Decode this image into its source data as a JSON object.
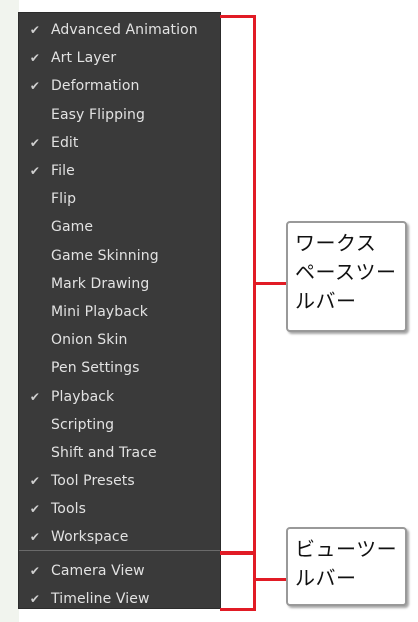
{
  "workspace_menu": {
    "items": [
      {
        "label": "Advanced Animation",
        "checked": true
      },
      {
        "label": "Art Layer",
        "checked": true
      },
      {
        "label": "Deformation",
        "checked": true
      },
      {
        "label": "Easy Flipping",
        "checked": false
      },
      {
        "label": "Edit",
        "checked": true
      },
      {
        "label": "File",
        "checked": true
      },
      {
        "label": "Flip",
        "checked": false
      },
      {
        "label": "Game",
        "checked": false
      },
      {
        "label": "Game Skinning",
        "checked": false
      },
      {
        "label": "Mark Drawing",
        "checked": false
      },
      {
        "label": "Mini Playback",
        "checked": false
      },
      {
        "label": "Onion Skin",
        "checked": false
      },
      {
        "label": "Pen Settings",
        "checked": false
      },
      {
        "label": "Playback",
        "checked": true
      },
      {
        "label": "Scripting",
        "checked": false
      },
      {
        "label": "Shift and Trace",
        "checked": false
      },
      {
        "label": "Tool Presets",
        "checked": true
      },
      {
        "label": "Tools",
        "checked": true
      },
      {
        "label": "Workspace",
        "checked": true
      }
    ]
  },
  "view_menu": {
    "items": [
      {
        "label": "Camera View",
        "checked": true
      },
      {
        "label": "Timeline View",
        "checked": true
      }
    ]
  },
  "check_mark": "✔",
  "callouts": {
    "workspace_toolbars": {
      "line1": "ワークス",
      "line2": "ペースツー",
      "line3": "ルバー"
    },
    "view_toolbars": {
      "line1": "ビューツー",
      "line2": "ルバー"
    }
  },
  "colors": {
    "menu_background": "#3a3a3a",
    "menu_text": "#e2e2e2",
    "bracket_red": "#e11b25",
    "callout_border": "#999999"
  }
}
